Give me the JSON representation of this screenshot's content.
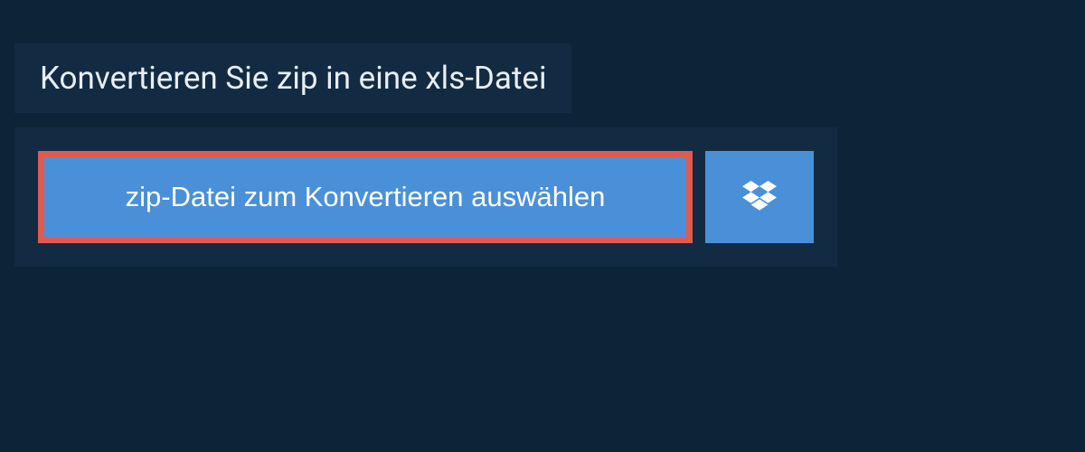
{
  "header": {
    "title": "Konvertieren Sie zip in eine xls-Datei"
  },
  "upload": {
    "select_button_label": "zip-Datei zum Konvertieren auswählen",
    "dropbox_icon": "dropbox"
  },
  "colors": {
    "page_bg": "#0d2438",
    "panel_bg": "#122b42",
    "button_bg": "#4a90d9",
    "highlight_border": "#e05a4f",
    "text_light": "#e8eef3",
    "text_white": "#ffffff"
  }
}
